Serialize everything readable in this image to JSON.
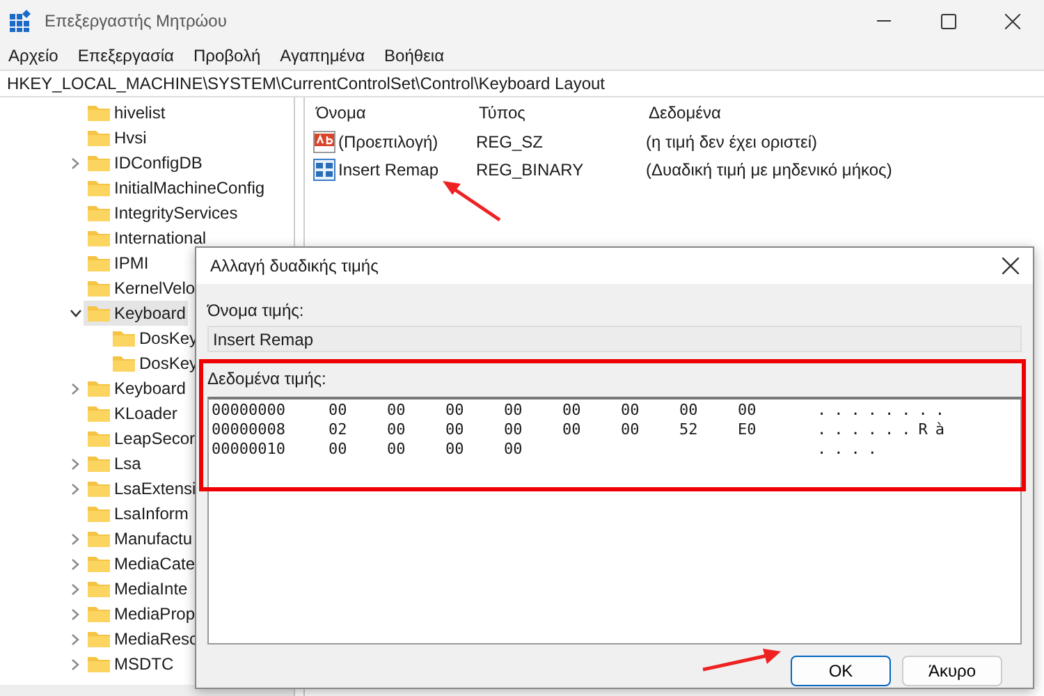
{
  "window": {
    "title": "Επεξεργαστής Μητρώου"
  },
  "menu": [
    "Αρχείο",
    "Επεξεργασία",
    "Προβολή",
    "Αγαπημένα",
    "Βοήθεια"
  ],
  "address": "HKEY_LOCAL_MACHINE\\SYSTEM\\CurrentControlSet\\Control\\Keyboard Layout",
  "tree": [
    {
      "label": "hivelist",
      "selected": false
    },
    {
      "label": "Hvsi",
      "selected": false
    },
    {
      "label": "IDConfigDB",
      "expanded": false,
      "selected": false
    },
    {
      "label": "InitialMachineConfig",
      "selected": false
    },
    {
      "label": "IntegrityServices",
      "selected": false
    },
    {
      "label": "International",
      "selected": false
    },
    {
      "label": "IPMI",
      "selected": false
    },
    {
      "label": "KernelVelo",
      "selected": false
    },
    {
      "label": "Keyboard",
      "expanded": true,
      "selected": true,
      "children": [
        {
          "label": "DosKey"
        },
        {
          "label": "DosKey"
        }
      ]
    },
    {
      "label": "Keyboard",
      "expanded": false,
      "selected": false
    },
    {
      "label": "KLoader",
      "selected": false
    },
    {
      "label": "LeapSecor",
      "selected": false
    },
    {
      "label": "Lsa",
      "expanded": false,
      "selected": false
    },
    {
      "label": "LsaExtensi",
      "expanded": false,
      "selected": false
    },
    {
      "label": "LsaInform",
      "selected": false
    },
    {
      "label": "Manufactu",
      "expanded": false,
      "selected": false
    },
    {
      "label": "MediaCate",
      "expanded": false,
      "selected": false
    },
    {
      "label": "MediaInte",
      "expanded": false,
      "selected": false
    },
    {
      "label": "MediaProp",
      "expanded": false,
      "selected": false
    },
    {
      "label": "MediaResc",
      "expanded": false,
      "selected": false
    },
    {
      "label": "MSDTC",
      "expanded": false,
      "selected": false
    }
  ],
  "values": {
    "columns": [
      "Όνομα",
      "Τύπος",
      "Δεδομένα"
    ],
    "rows": [
      {
        "kind": "string",
        "name": "(Προεπιλογή)",
        "type": "REG_SZ",
        "data": "(η τιμή δεν έχει οριστεί)"
      },
      {
        "kind": "binary",
        "name": "Insert Remap",
        "type": "REG_BINARY",
        "data": "(Δυαδική τιμή με μηδενικό μήκος)"
      }
    ]
  },
  "dialog": {
    "title": "Αλλαγή δυαδικής τιμής",
    "name_label": "Όνομα τιμής:",
    "name_value": "Insert Remap",
    "data_label": "Δεδομένα τιμής:",
    "hex_rows": [
      {
        "address": "00000000",
        "bytes": [
          "00",
          "00",
          "00",
          "00",
          "00",
          "00",
          "00",
          "00"
        ],
        "ascii": "........"
      },
      {
        "address": "00000008",
        "bytes": [
          "02",
          "00",
          "00",
          "00",
          "00",
          "00",
          "52",
          "E0"
        ],
        "ascii": "......Rà"
      },
      {
        "address": "00000010",
        "bytes": [
          "00",
          "00",
          "00",
          "00"
        ],
        "ascii": "...."
      }
    ],
    "buttons": [
      {
        "label": "OK",
        "default": true
      },
      {
        "label": "Άκυρο",
        "default": false
      }
    ]
  }
}
